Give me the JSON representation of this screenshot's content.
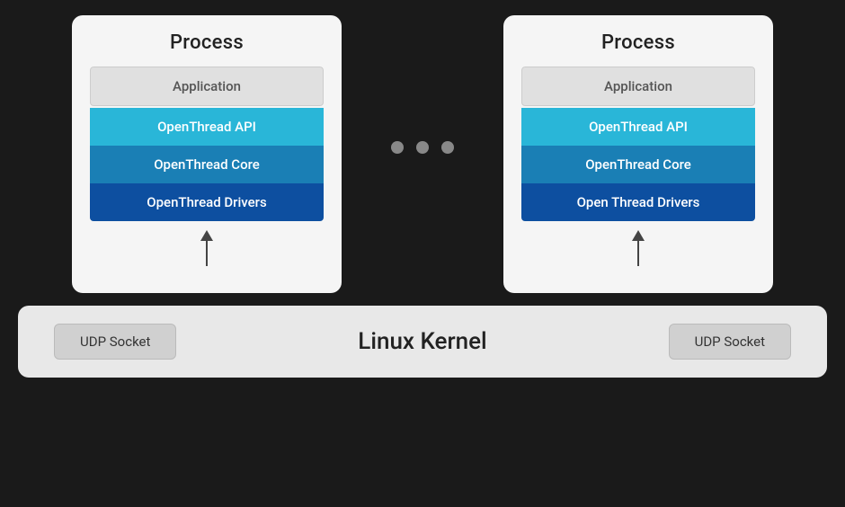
{
  "diagram": {
    "background": "#1a1a1a",
    "process_left": {
      "title": "Process",
      "layers": {
        "application": "Application",
        "api": "OpenThread API",
        "core": "OpenThread Core",
        "drivers": "OpenThread Drivers"
      }
    },
    "process_right": {
      "title": "Process",
      "layers": {
        "application": "Application",
        "api": "OpenThread API",
        "core": "OpenThread Core",
        "drivers": "Open Thread Drivers"
      }
    },
    "dots": [
      "•",
      "•",
      "•"
    ],
    "kernel": {
      "label": "Linux Kernel",
      "udp_left": "UDP Socket",
      "udp_right": "UDP Socket"
    }
  }
}
